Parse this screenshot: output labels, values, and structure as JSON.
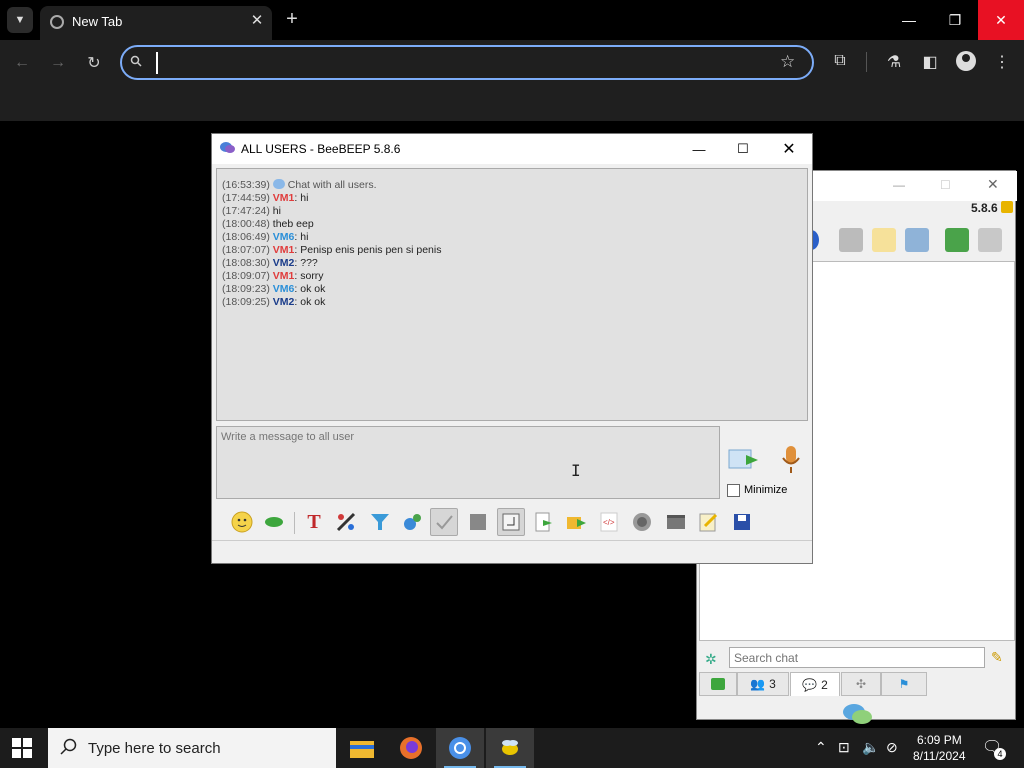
{
  "browser": {
    "tab_title": "New Tab",
    "omnibox_value": ""
  },
  "beebeep": {
    "title": "ALL USERS - BeeBEEP 5.8.6",
    "version_label": "5.8.6",
    "chat": [
      {
        "time": "(16:53:39)",
        "name": "",
        "text": "Chat with all users.",
        "color": "#555555"
      },
      {
        "time": "(17:44:59)",
        "name": "VM1",
        "text": ": hi",
        "color": "#e03c3c"
      },
      {
        "time": "(17:47:24)",
        "name": "",
        "text": "hi",
        "color": "#222222"
      },
      {
        "time": "(18:00:48)",
        "name": "",
        "text": "theb eep",
        "color": "#222222"
      },
      {
        "time": "(18:06:49)",
        "name": "VM6",
        "text": ": hi",
        "color": "#2a8fd8"
      },
      {
        "time": "(18:07:07)",
        "name": "VM1",
        "text": ": Penisp enis penis pen si penis",
        "color": "#e03c3c"
      },
      {
        "time": "(18:08:30)",
        "name": "VM2",
        "text": ": ???",
        "color": "#1a3c8a"
      },
      {
        "time": "(18:09:07)",
        "name": "VM1",
        "text": ": sorry",
        "color": "#e03c3c"
      },
      {
        "time": "(18:09:23)",
        "name": "VM6",
        "text": ": ok ok",
        "color": "#2a8fd8"
      },
      {
        "time": "(18:09:25)",
        "name": "VM2",
        "text": ": ok ok",
        "color": "#1a3c8a"
      }
    ],
    "input_placeholder": "Write a message to all user",
    "minimize_label": "Minimize",
    "search_placeholder": "Search chat",
    "tab_users_count": "3",
    "tab_chats_count": "2"
  },
  "taskbar": {
    "search_text": "Type here to search",
    "time": "6:09 PM",
    "date": "8/11/2024",
    "notification_count": "4"
  }
}
